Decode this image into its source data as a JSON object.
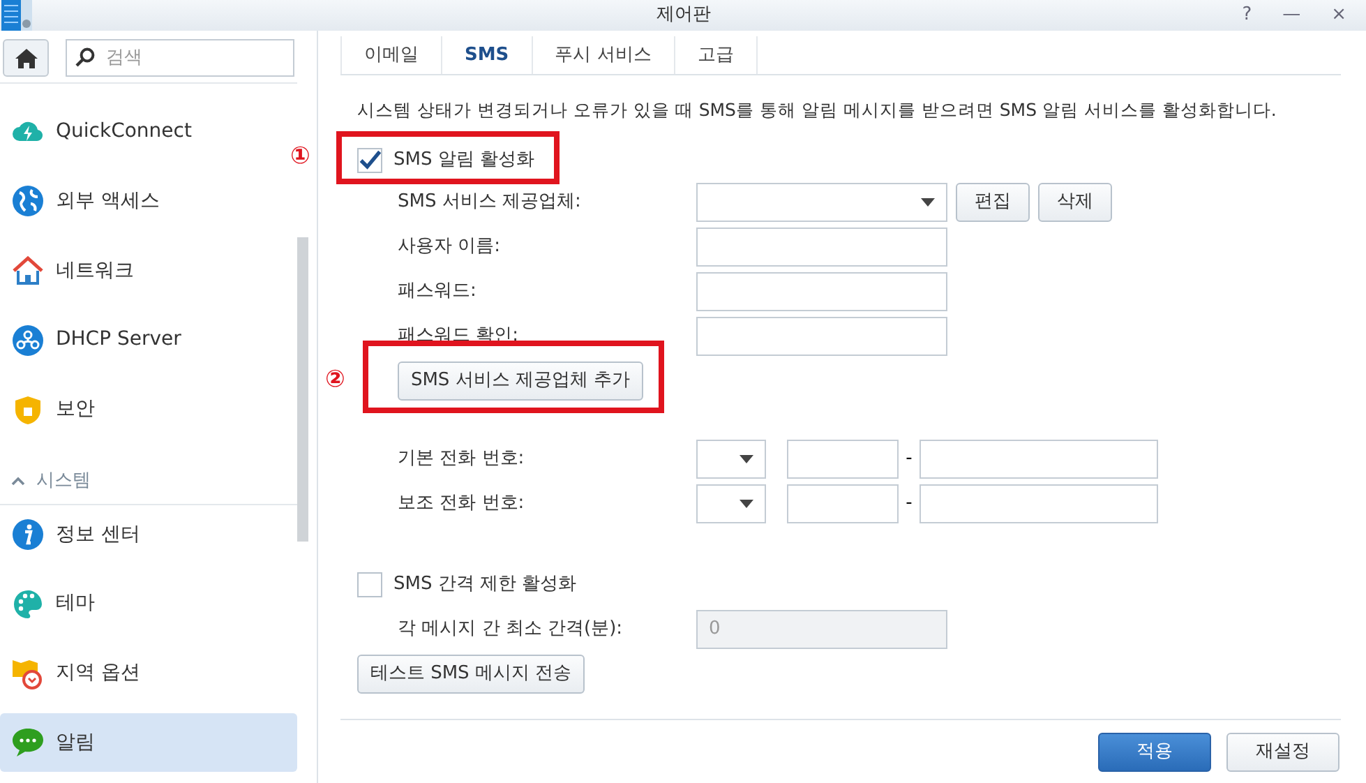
{
  "window": {
    "title": "제어판",
    "controls": [
      "?",
      "—",
      "×"
    ]
  },
  "search": {
    "placeholder": "검색"
  },
  "sidebar": [
    {
      "kind": "item",
      "label": "QuickConnect",
      "selected": false
    },
    {
      "kind": "item",
      "label": "외부 액세스",
      "selected": false
    },
    {
      "kind": "item",
      "label": "네트워크",
      "selected": false
    },
    {
      "kind": "item",
      "label": "DHCP Server",
      "selected": false
    },
    {
      "kind": "item",
      "label": "보안",
      "selected": false
    },
    {
      "kind": "header",
      "label": "시스템",
      "expanded": true
    },
    {
      "kind": "item",
      "label": "정보 센터",
      "selected": false
    },
    {
      "kind": "item",
      "label": "테마",
      "selected": false
    },
    {
      "kind": "item",
      "label": "지역 옵션",
      "selected": false
    },
    {
      "kind": "item",
      "label": "알림",
      "selected": true
    }
  ],
  "tabs": [
    {
      "label": "이메일",
      "selected": false
    },
    {
      "label": "SMS",
      "selected": true
    },
    {
      "label": "푸시 서비스",
      "selected": false
    },
    {
      "label": "고급",
      "selected": false
    }
  ],
  "description": "시스템 상태가 변경되거나 오류가 있을 때 SMS를 통해 알림 메시지를 받으려면 SMS 알림 서비스를 활성화합니다.",
  "enable_sms": {
    "label": "SMS 알림 활성화",
    "checked": true,
    "annotation": "①"
  },
  "provider": {
    "label": "SMS 서비스 제공업체:",
    "buttons": [
      "편집",
      "삭제"
    ]
  },
  "fields": [
    {
      "label": "사용자 이름:"
    },
    {
      "label": "패스워드:"
    },
    {
      "label": "패스워드 확인:"
    }
  ],
  "add_provider": {
    "label": "SMS 서비스 제공업체 추가",
    "annotation": "②"
  },
  "phones": [
    {
      "label": "기본 전화 번호:",
      "separator": "-"
    },
    {
      "label": "보조 전화 번호:",
      "separator": "-"
    }
  ],
  "interval_limit": {
    "label": "SMS 간격 제한 활성화",
    "checked": false
  },
  "interval": {
    "label": "각 메시지 간 최소 간격(분):",
    "value": "0",
    "disabled": true
  },
  "test_button": "테스트 SMS 메시지 전송",
  "footer": [
    {
      "label": "적용",
      "kind": "primary"
    },
    {
      "label": "재설정",
      "kind": "secondary"
    }
  ]
}
